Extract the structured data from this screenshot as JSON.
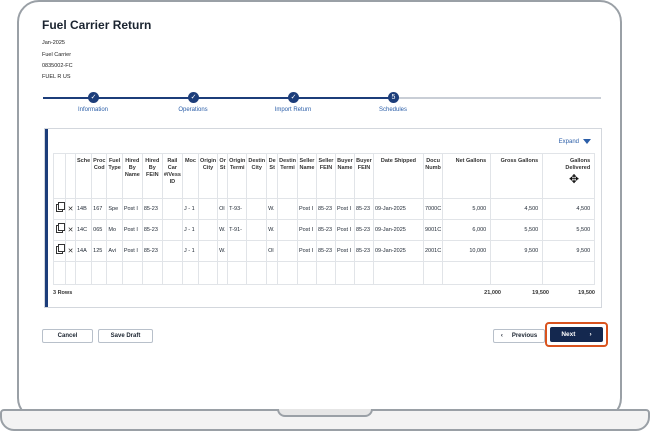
{
  "page": {
    "title": "Fuel Carrier Return",
    "meta_lines": [
      "Jan-2025",
      "Fuel Carrier",
      "0835002-FC",
      "FUEL R US"
    ]
  },
  "stepper": {
    "steps": [
      {
        "label": "Information",
        "icon": "check-icon",
        "glyph": "✓"
      },
      {
        "label": "Operations",
        "icon": "check-icon",
        "glyph": "✓"
      },
      {
        "label": "Import Return",
        "icon": "check-icon",
        "glyph": "✓"
      },
      {
        "label": "Schedules",
        "icon": "step-number",
        "glyph": "5"
      }
    ]
  },
  "grid": {
    "expand_label": "Expand",
    "headers": [
      "",
      "",
      "Sche",
      "Proc Cod",
      "Fuel Type",
      "Hired By Name",
      "Hired By FEIN",
      "Rail Car #/Vess ID",
      "Moc",
      "Origin City",
      "Or St",
      "Origin Termi",
      "Destin City",
      "De St",
      "Destin Termi",
      "Seller Name",
      "Seller FEIN",
      "Buyer Name",
      "Buyer FEIN",
      "Date Shipped",
      "Docu Numb",
      "Net Gallons",
      "Gross Gallons",
      "Gallons Delivered"
    ],
    "rows": [
      [
        "",
        "",
        "14B",
        "167",
        "Spe",
        "Post I",
        "85-23",
        "",
        "J - 1",
        "",
        "Ol",
        "T-93-",
        "",
        "W.",
        "",
        "Post I",
        "85-23",
        "Post I",
        "85-23",
        "09-Jan-2025",
        "7000C",
        "5,000",
        "4,500",
        "4,500"
      ],
      [
        "",
        "",
        "14C",
        "065",
        "Mo",
        "Post I",
        "85-23",
        "",
        "J - 1",
        "",
        "W.",
        "T-91-",
        "",
        "W.",
        "",
        "Post I",
        "85-23",
        "Post I",
        "85-23",
        "09-Jan-2025",
        "9001C",
        "6,000",
        "5,500",
        "5,500"
      ],
      [
        "",
        "",
        "14A",
        "125",
        "Avi",
        "Post I",
        "85-23",
        "",
        "J - 1",
        "",
        "W.",
        "",
        "",
        "Ol",
        "",
        "Post I",
        "85-23",
        "Post I",
        "85-23",
        "09-Jan-2025",
        "2001C",
        "10,000",
        "9,500",
        "9,500"
      ]
    ],
    "row_count": "3 Rows",
    "totals": {
      "net": "21,000",
      "gross": "19,500",
      "delivered": "19,500"
    }
  },
  "footer": {
    "cancel": "Cancel",
    "save_draft": "Save Draft",
    "previous": "Previous",
    "next": "Next"
  },
  "colors": {
    "accent": "#1c3d7a",
    "link": "#2b5ea8",
    "highlight": "#d9531e"
  }
}
